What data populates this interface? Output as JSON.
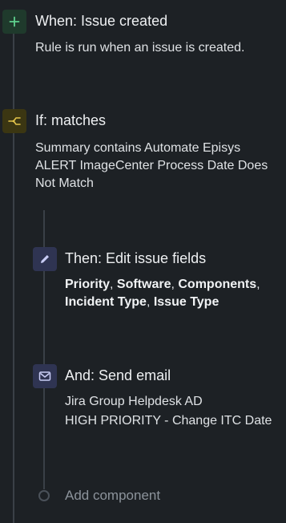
{
  "trigger": {
    "icon": "plus-icon",
    "title": "When: Issue created",
    "description": "Rule is run when an issue is created."
  },
  "condition": {
    "icon": "branch-icon",
    "title": "If: matches",
    "description": "Summary contains Automate Episys ALERT ImageCenter Process Date Does Not Match"
  },
  "actions": [
    {
      "icon": "pencil-icon",
      "title": "Then: Edit issue fields",
      "fields": [
        "Priority",
        "Software",
        "Components",
        "Incident Type",
        "Issue Type"
      ],
      "separator": ", "
    },
    {
      "icon": "mail-icon",
      "title": "And: Send email",
      "recipient": "Jira Group Helpdesk AD",
      "subject": "HIGH PRIORITY - Change ITC Date"
    }
  ],
  "add_component": {
    "label": "Add component"
  },
  "colors": {
    "background": "#1d2125",
    "trigger_icon": "#5fd18e",
    "condition_icon": "#e2c44a",
    "action_icon": "#c9cdf5"
  }
}
